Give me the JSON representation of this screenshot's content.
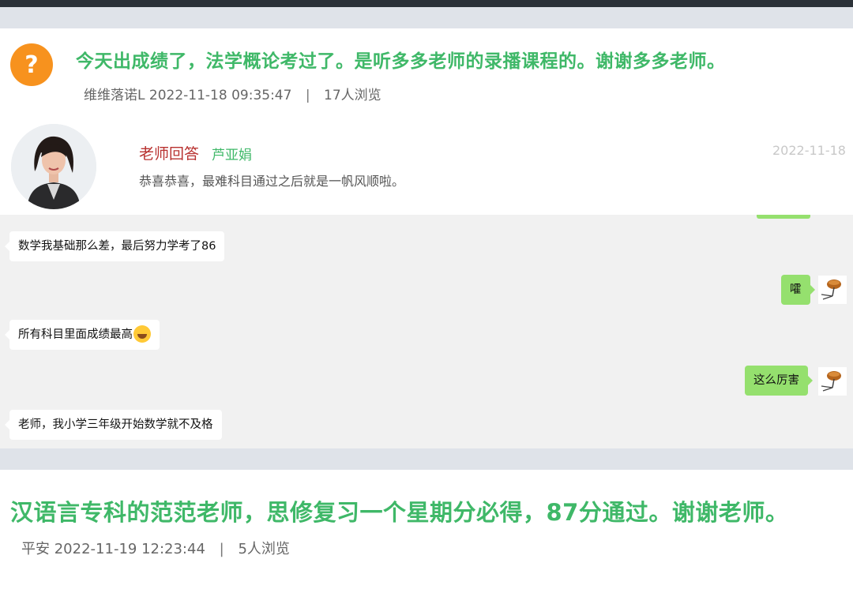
{
  "post1": {
    "icon": "question-mark-icon",
    "icon_glyph": "?",
    "title": "今天出成绩了，法学概论考过了。是听多多老师的录播课程的。谢谢多多老师。",
    "author": "维维落诺L",
    "datetime": "2022-11-18 09:35:47",
    "separator": "|",
    "views": "17人浏览",
    "answer": {
      "label": "老师回答",
      "teacher": "芦亚娟",
      "text": "恭喜恭喜，最难科目通过之后就是一帆风顺啦。",
      "date": "2022-11-18"
    }
  },
  "chat": {
    "messages": [
      {
        "side": "left",
        "text": "数学我基础那么差，最后努力学考了86"
      },
      {
        "side": "right",
        "text": "嚯"
      },
      {
        "side": "left",
        "text": "所有科目里面成绩最高",
        "emoji": "laughing-tears-emoji"
      },
      {
        "side": "right",
        "text": "这么厉害"
      },
      {
        "side": "left",
        "text": "老师，我小学三年级开始数学就不及格"
      }
    ]
  },
  "post2": {
    "title": "汉语言专科的范范老师，思修复习一个星期分必得，87分通过。谢谢老师。",
    "author": "平安",
    "datetime": "2022-11-19 12:23:44",
    "separator": "|",
    "views": "5人浏览"
  },
  "colors": {
    "title_green": "#3fb868",
    "answer_red": "#b8312f",
    "question_orange": "#f7921e",
    "chat_green": "#95e06e",
    "topbar": "#2b3138",
    "gap_gray": "#dfe3e9"
  }
}
